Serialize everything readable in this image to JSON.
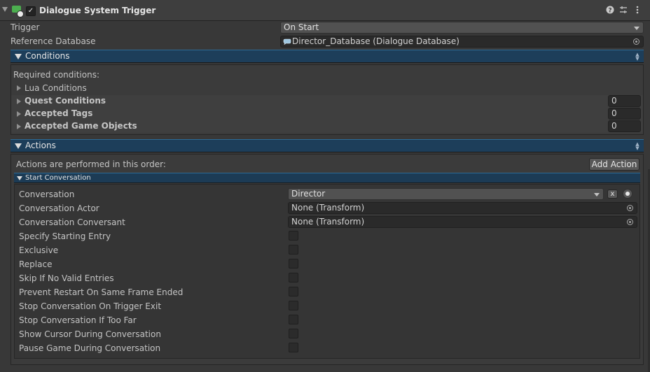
{
  "component": {
    "title": "Dialogue System Trigger",
    "enabled": true
  },
  "fields": {
    "trigger_label": "Trigger",
    "trigger_value": "On Start",
    "reference_db_label": "Reference Database",
    "reference_db_value": "Director_Database (Dialogue Database)"
  },
  "conditions": {
    "header": "Conditions",
    "required_label": "Required conditions:",
    "items": [
      {
        "label": "Lua Conditions"
      },
      {
        "label": "Quest Conditions",
        "count": "0"
      },
      {
        "label": "Accepted Tags",
        "count": "0"
      },
      {
        "label": "Accepted Game Objects",
        "count": "0"
      }
    ]
  },
  "actions": {
    "header": "Actions",
    "order_label": "Actions are performed in this order:",
    "add_action_label": "Add Action",
    "start_conversation": {
      "header": "Start Conversation",
      "conversation_label": "Conversation",
      "conversation_value": "Director",
      "clear_label": "x",
      "actor_label": "Conversation Actor",
      "actor_value": "None (Transform)",
      "conversant_label": "Conversation Conversant",
      "conversant_value": "None (Transform)",
      "toggles": [
        {
          "label": "Specify Starting Entry",
          "checked": false
        },
        {
          "label": "Exclusive",
          "checked": false
        },
        {
          "label": "Replace",
          "checked": false
        },
        {
          "label": "Skip If No Valid Entries",
          "checked": false
        },
        {
          "label": "Prevent Restart On Same Frame Ended",
          "checked": false
        },
        {
          "label": "Stop Conversation On Trigger Exit",
          "checked": false
        },
        {
          "label": "Stop Conversation If Too Far",
          "checked": false
        },
        {
          "label": "Show Cursor During Conversation",
          "checked": false
        },
        {
          "label": "Pause Game During Conversation",
          "checked": false
        }
      ]
    }
  },
  "icons": {
    "component": "dialogue-trigger-component-icon",
    "help": "help-icon",
    "presets": "presets-icon",
    "menu": "kebab-menu-icon",
    "picker": "object-picker-icon",
    "database": "dialogue-database-icon"
  }
}
